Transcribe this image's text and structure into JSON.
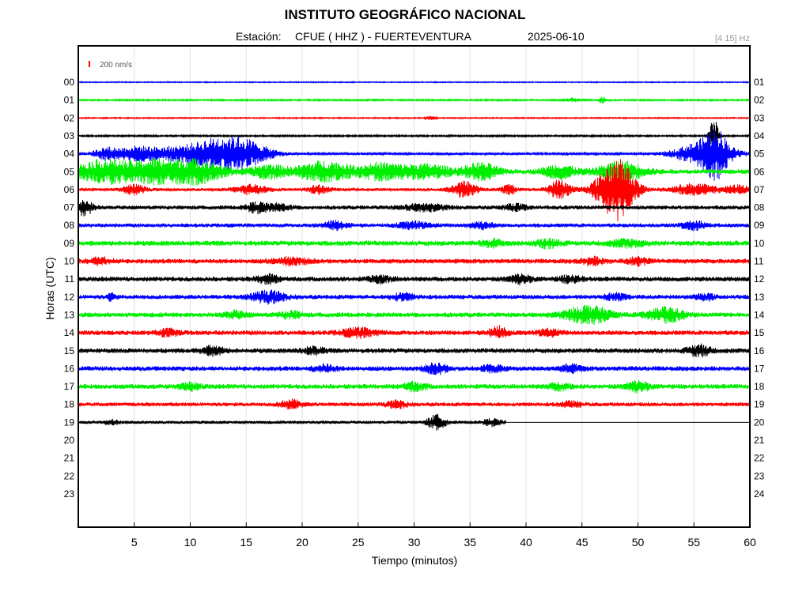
{
  "header": {
    "title": "INSTITUTO GEOGRÁFICO NACIONAL",
    "station_label": "Estación:",
    "station": "CFUE ( HHZ ) - FUERTEVENTURA",
    "date": "2025-06-10",
    "filter": "[4 15] Hz"
  },
  "chart_data": {
    "type": "line",
    "title": "INSTITUTO GEOGRÁFICO NACIONAL",
    "xlabel": "Tiempo (minutos)",
    "ylabel": "Horas (UTC)",
    "xlim": [
      0,
      60
    ],
    "x_ticks": [
      "5",
      "10",
      "15",
      "20",
      "25",
      "30",
      "35",
      "40",
      "45",
      "50",
      "55",
      "60"
    ],
    "left_labels": [
      "00",
      "01",
      "02",
      "03",
      "04",
      "05",
      "06",
      "07",
      "08",
      "09",
      "10",
      "11",
      "12",
      "13",
      "14",
      "15",
      "16",
      "17",
      "18",
      "19",
      "20",
      "21",
      "22",
      "23"
    ],
    "right_labels": [
      "01",
      "02",
      "03",
      "04",
      "05",
      "06",
      "07",
      "08",
      "09",
      "10",
      "11",
      "12",
      "13",
      "14",
      "15",
      "16",
      "17",
      "18",
      "19",
      "20",
      "21",
      "22",
      "23",
      "24"
    ],
    "scale_bar": "200 nm/s",
    "grid": true,
    "colors": [
      "#0000ff",
      "#00ee00",
      "#ff0000",
      "#000000"
    ],
    "data_end_minute": 38.2,
    "traces": [
      {
        "hour": "00",
        "color": "#0000ff",
        "noise": 0.6,
        "events": []
      },
      {
        "hour": "01",
        "color": "#00ee00",
        "noise": 0.9,
        "events": [
          [
            44.2,
            0.6,
            2.5
          ],
          [
            46.8,
            0.3,
            4
          ]
        ]
      },
      {
        "hour": "02",
        "color": "#ff0000",
        "noise": 0.7,
        "events": [
          [
            31.5,
            0.4,
            3
          ]
        ]
      },
      {
        "hour": "03",
        "color": "#000000",
        "noise": 1.0,
        "events": [
          [
            56.8,
            0.4,
            22
          ]
        ]
      },
      {
        "hour": "04",
        "color": "#0000ff",
        "noise": 1.3,
        "events": [
          [
            2.5,
            1.2,
            7
          ],
          [
            5,
            1.5,
            6
          ],
          [
            9,
            4,
            9
          ],
          [
            14.5,
            2.5,
            18
          ],
          [
            12,
            2,
            8
          ],
          [
            56,
            2.5,
            16
          ],
          [
            57,
            1,
            20
          ]
        ]
      },
      {
        "hour": "05",
        "color": "#00ee00",
        "noise": 3.0,
        "events": [
          [
            2.5,
            3,
            14
          ],
          [
            7,
            2,
            12
          ],
          [
            10.5,
            2.5,
            14
          ],
          [
            17,
            1.5,
            8
          ],
          [
            22,
            2.5,
            12
          ],
          [
            27,
            2,
            9
          ],
          [
            31,
            2.5,
            8
          ],
          [
            36,
            1.5,
            10
          ],
          [
            43,
            1.5,
            8
          ],
          [
            48.5,
            2,
            12
          ]
        ]
      },
      {
        "hour": "06",
        "color": "#ff0000",
        "noise": 1.8,
        "events": [
          [
            5,
            1,
            6
          ],
          [
            15.5,
            1.5,
            6
          ],
          [
            21.5,
            1,
            5
          ],
          [
            34.5,
            1.2,
            10
          ],
          [
            38.5,
            0.7,
            6
          ],
          [
            43,
            1,
            12
          ],
          [
            47,
            1.5,
            10
          ],
          [
            48.3,
            1.5,
            34
          ],
          [
            55,
            2,
            7
          ],
          [
            59,
            1.2,
            5
          ]
        ]
      },
      {
        "hour": "07",
        "color": "#000000",
        "noise": 2.5,
        "events": [
          [
            0.5,
            0.8,
            9
          ],
          [
            16,
            1,
            6
          ],
          [
            18,
            1,
            4
          ],
          [
            31,
            2,
            4
          ],
          [
            39,
            1,
            4
          ]
        ]
      },
      {
        "hour": "08",
        "color": "#0000ff",
        "noise": 2.5,
        "events": [
          [
            23,
            1,
            5
          ],
          [
            30,
            1.5,
            4
          ],
          [
            36,
            1,
            4
          ],
          [
            55,
            1,
            6
          ]
        ]
      },
      {
        "hour": "09",
        "color": "#00ee00",
        "noise": 3.2,
        "events": [
          [
            37,
            1,
            4
          ],
          [
            42,
            1,
            5
          ],
          [
            49,
            1.5,
            4
          ]
        ]
      },
      {
        "hour": "10",
        "color": "#ff0000",
        "noise": 3.0,
        "events": [
          [
            2,
            1,
            4
          ],
          [
            19,
            1.5,
            4
          ],
          [
            46,
            1,
            4
          ],
          [
            50,
            1,
            4
          ]
        ]
      },
      {
        "hour": "11",
        "color": "#000000",
        "noise": 3.0,
        "events": [
          [
            17,
            1,
            5
          ],
          [
            27,
            1,
            4
          ],
          [
            39.5,
            1,
            5
          ],
          [
            44,
            1,
            4
          ]
        ]
      },
      {
        "hour": "12",
        "color": "#0000ff",
        "noise": 2.8,
        "events": [
          [
            3,
            0.3,
            6
          ],
          [
            17,
            1.5,
            7
          ],
          [
            29,
            1,
            4
          ],
          [
            48,
            1,
            4
          ],
          [
            56,
            0.8,
            4
          ]
        ]
      },
      {
        "hour": "13",
        "color": "#00ee00",
        "noise": 3.0,
        "events": [
          [
            14,
            1,
            4
          ],
          [
            19,
            1,
            4
          ],
          [
            45.5,
            2,
            11
          ],
          [
            52.5,
            1.5,
            9
          ]
        ]
      },
      {
        "hour": "14",
        "color": "#ff0000",
        "noise": 3.0,
        "events": [
          [
            8,
            1,
            4
          ],
          [
            25,
            1.5,
            5
          ],
          [
            37.5,
            0.8,
            7
          ],
          [
            42,
            1,
            4
          ]
        ]
      },
      {
        "hour": "15",
        "color": "#000000",
        "noise": 3.0,
        "events": [
          [
            12,
            1,
            5
          ],
          [
            21,
            1,
            4
          ],
          [
            55.5,
            1,
            7
          ]
        ]
      },
      {
        "hour": "16",
        "color": "#0000ff",
        "noise": 3.0,
        "events": [
          [
            22,
            1,
            4
          ],
          [
            32,
            1,
            6
          ],
          [
            37,
            1,
            4
          ],
          [
            44,
            1,
            4
          ]
        ]
      },
      {
        "hour": "17",
        "color": "#00ee00",
        "noise": 3.0,
        "events": [
          [
            10,
            1,
            4
          ],
          [
            30,
            1,
            5
          ],
          [
            43,
            1,
            4
          ],
          [
            50,
            1,
            6
          ]
        ]
      },
      {
        "hour": "18",
        "color": "#ff0000",
        "noise": 2.5,
        "events": [
          [
            19,
            1,
            5
          ],
          [
            28.5,
            1,
            4
          ],
          [
            44,
            1,
            3
          ]
        ]
      },
      {
        "hour": "19",
        "color": "#000000",
        "noise": 2.0,
        "events": [
          [
            3,
            0.6,
            3
          ],
          [
            32,
            0.8,
            9
          ],
          [
            37,
            0.8,
            4
          ]
        ]
      }
    ]
  }
}
